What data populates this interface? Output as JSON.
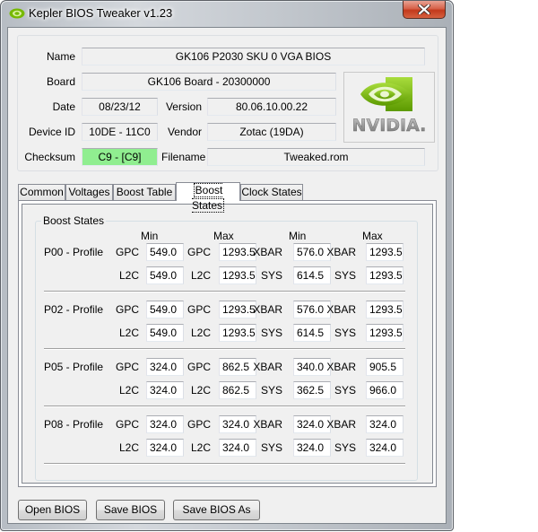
{
  "window": {
    "title": "Kepler BIOS Tweaker v1.23",
    "close_icon": "close-x-icon",
    "app_icon": "nvidia-eye-icon"
  },
  "info": {
    "name": {
      "label": "Name",
      "value": "GK106 P2030 SKU 0 VGA BIOS"
    },
    "board": {
      "label": "Board",
      "value": "GK106 Board - 20300000"
    },
    "date": {
      "label": "Date",
      "value": "08/23/12"
    },
    "version": {
      "label": "Version",
      "value": "80.06.10.00.22"
    },
    "device_id": {
      "label": "Device ID",
      "value": "10DE - 11C0"
    },
    "vendor": {
      "label": "Vendor",
      "value": "Zotac (19DA)"
    },
    "checksum": {
      "label": "Checksum",
      "value": "C9 - [C9]",
      "color": "#90ee90"
    },
    "filename": {
      "label": "Filename",
      "value": "Tweaked.rom"
    },
    "logo": {
      "text": "NVIDIA.",
      "icon": "nvidia-logo-icon",
      "accent": "#76b900"
    }
  },
  "tabs": [
    {
      "label": "Common",
      "active": false
    },
    {
      "label": "Voltages",
      "active": false
    },
    {
      "label": "Boost Table",
      "active": false
    },
    {
      "label": "Boost States",
      "active": true
    },
    {
      "label": "Clock States",
      "active": false
    }
  ],
  "boost_states": {
    "group_title": "Boost States",
    "column_headers": [
      "Min",
      "Max",
      "Min",
      "Max"
    ],
    "profiles": [
      {
        "label": "P00 - Profile",
        "row1": [
          {
            "label": "GPC",
            "value": "549.0"
          },
          {
            "label": "GPC",
            "value": "1293.5"
          },
          {
            "label": "XBAR",
            "value": "576.0"
          },
          {
            "label": "XBAR",
            "value": "1293.5"
          }
        ],
        "row2": [
          {
            "label": "L2C",
            "value": "549.0"
          },
          {
            "label": "L2C",
            "value": "1293.5"
          },
          {
            "label": "SYS",
            "value": "614.5"
          },
          {
            "label": "SYS",
            "value": "1293.5"
          }
        ]
      },
      {
        "label": "P02 - Profile",
        "row1": [
          {
            "label": "GPC",
            "value": "549.0"
          },
          {
            "label": "GPC",
            "value": "1293.5"
          },
          {
            "label": "XBAR",
            "value": "576.0"
          },
          {
            "label": "XBAR",
            "value": "1293.5"
          }
        ],
        "row2": [
          {
            "label": "L2C",
            "value": "549.0"
          },
          {
            "label": "L2C",
            "value": "1293.5"
          },
          {
            "label": "SYS",
            "value": "614.5"
          },
          {
            "label": "SYS",
            "value": "1293.5"
          }
        ]
      },
      {
        "label": "P05 - Profile",
        "row1": [
          {
            "label": "GPC",
            "value": "324.0"
          },
          {
            "label": "GPC",
            "value": "862.5"
          },
          {
            "label": "XBAR",
            "value": "340.0"
          },
          {
            "label": "XBAR",
            "value": "905.5"
          }
        ],
        "row2": [
          {
            "label": "L2C",
            "value": "324.0"
          },
          {
            "label": "L2C",
            "value": "862.5"
          },
          {
            "label": "SYS",
            "value": "362.5"
          },
          {
            "label": "SYS",
            "value": "966.0"
          }
        ]
      },
      {
        "label": "P08 - Profile",
        "row1": [
          {
            "label": "GPC",
            "value": "324.0"
          },
          {
            "label": "GPC",
            "value": "324.0"
          },
          {
            "label": "XBAR",
            "value": "324.0"
          },
          {
            "label": "XBAR",
            "value": "324.0"
          }
        ],
        "row2": [
          {
            "label": "L2C",
            "value": "324.0"
          },
          {
            "label": "L2C",
            "value": "324.0"
          },
          {
            "label": "SYS",
            "value": "324.0"
          },
          {
            "label": "SYS",
            "value": "324.0"
          }
        ]
      }
    ]
  },
  "buttons": {
    "open": "Open BIOS",
    "save": "Save BIOS",
    "save_as": "Save BIOS As"
  }
}
